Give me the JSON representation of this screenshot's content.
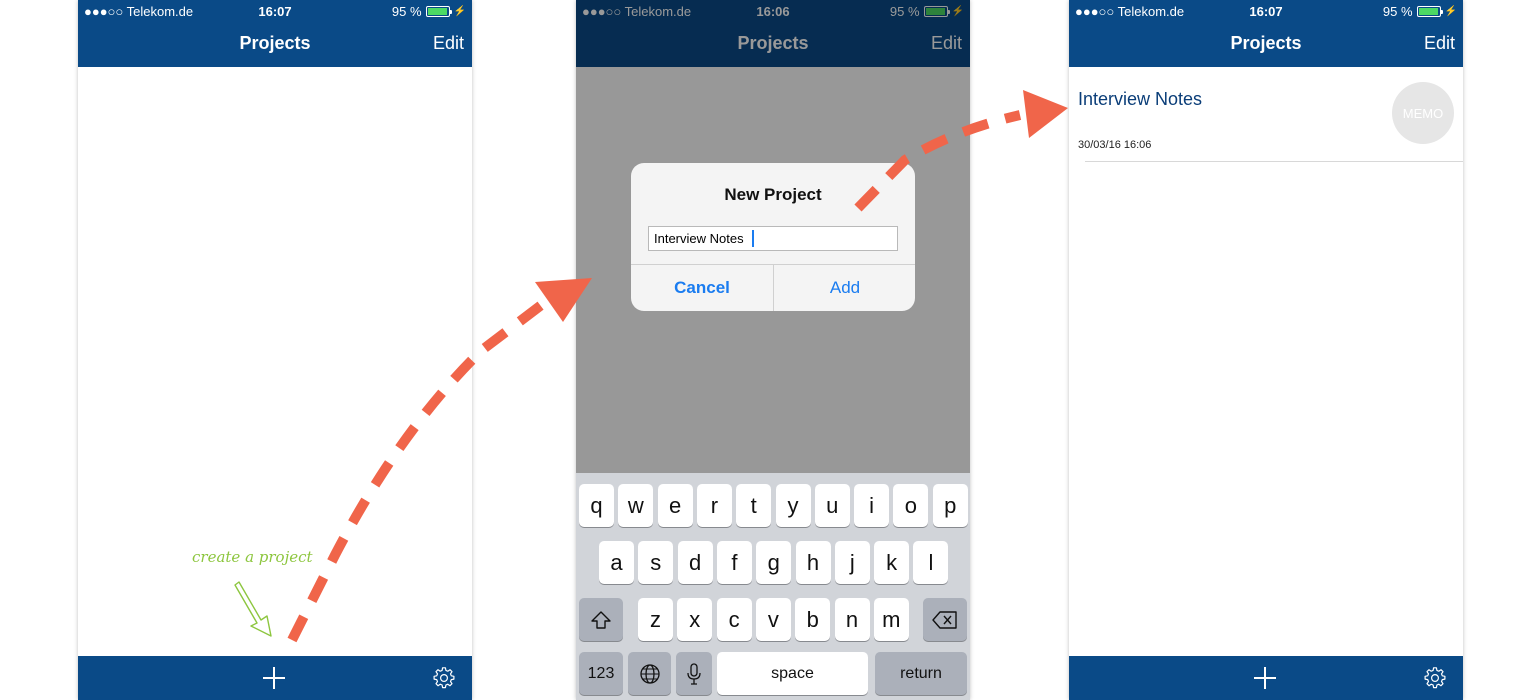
{
  "status_bar": [
    {
      "carrier": "●●●○○ Telekom.de",
      "time": "16:07",
      "battery": "95 %"
    },
    {
      "carrier": "●●●○○ Telekom.de",
      "time": "16:06",
      "battery": "95 %"
    },
    {
      "carrier": "●●●○○ Telekom.de",
      "time": "16:07",
      "battery": "95 %"
    }
  ],
  "nav": {
    "title": "Projects",
    "edit_label": "Edit"
  },
  "annotation": {
    "hint": "create a project"
  },
  "dialog": {
    "title": "New Project",
    "input_value": "Interview Notes",
    "cancel_label": "Cancel",
    "add_label": "Add"
  },
  "keyboard": {
    "row1": [
      "q",
      "w",
      "e",
      "r",
      "t",
      "y",
      "u",
      "i",
      "o",
      "p"
    ],
    "row2": [
      "a",
      "s",
      "d",
      "f",
      "g",
      "h",
      "j",
      "k",
      "l"
    ],
    "row3": [
      "z",
      "x",
      "c",
      "v",
      "b",
      "n",
      "m"
    ],
    "numbers_label": "123",
    "space_label": "space",
    "return_label": "return",
    "icons": [
      "shift-icon",
      "backspace-icon",
      "globe-icon",
      "microphone-icon"
    ]
  },
  "project_list": [
    {
      "title": "Interview Notes",
      "date": "30/03/16 16:06",
      "badge": "MEMO"
    }
  ],
  "colors": {
    "nav_bar": "#0a4a87",
    "annotation_arrow": "#f0654a",
    "hint_text": "#8dc63f",
    "ios_blue": "#1a7cf0",
    "battery_green": "#4cd964"
  }
}
